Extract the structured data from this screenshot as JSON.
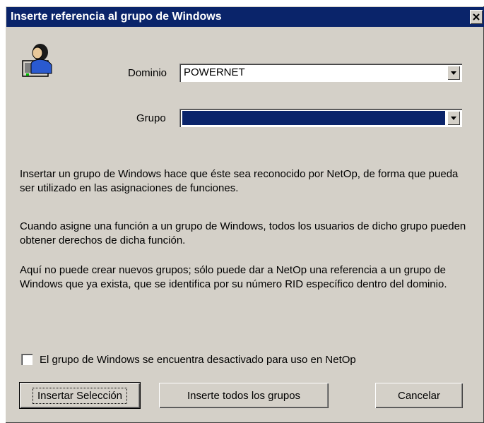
{
  "window": {
    "title": "Inserte referencia al grupo de Windows"
  },
  "icons": {
    "user": "user-computer-icon",
    "close": "close-icon",
    "dropdown": "chevron-down-icon"
  },
  "form": {
    "domain_label": "Dominio",
    "domain_value": "POWERNET",
    "group_label": "Grupo",
    "group_value": ""
  },
  "info": {
    "para1": "Insertar un grupo de Windows hace que éste sea reconocido por NetOp, de forma que pueda ser utilizado en las asignaciones de funciones.",
    "para2": "Cuando asigne una función a un grupo de Windows, todos los usuarios de dicho grupo pueden obtener derechos de dicha función.",
    "para3": "Aquí no puede crear nuevos grupos; sólo puede dar a NetOp una referencia a un grupo de Windows que ya exista, que se identifica por su número RID específico dentro del dominio."
  },
  "checkbox": {
    "label": "El grupo de Windows se encuentra desactivado para uso en NetOp",
    "checked": false
  },
  "buttons": {
    "insert_selection": "Insertar Selección",
    "insert_all": "Inserte todos los grupos",
    "cancel": "Cancelar"
  },
  "colors": {
    "face": "#d4d0c8",
    "title_bar": "#0a246a",
    "selection": "#0a246a"
  }
}
